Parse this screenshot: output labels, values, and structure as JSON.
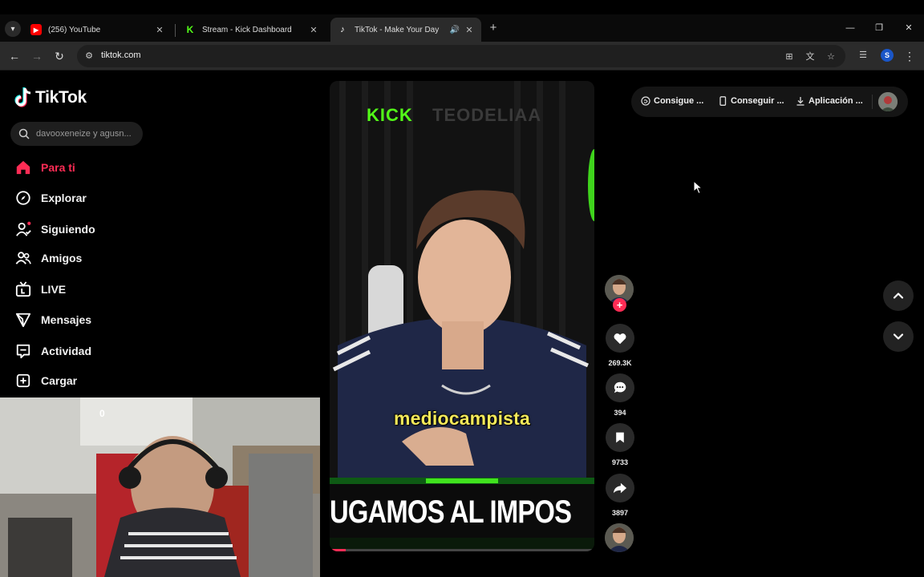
{
  "browser": {
    "tabs": [
      {
        "title": "(256) YouTube",
        "favicon": "youtube-icon",
        "color": "#ff0000"
      },
      {
        "title": "Stream - Kick Dashboard",
        "favicon": "kick-icon",
        "color": "#53fc18"
      },
      {
        "title": "TikTok - Make Your Day",
        "favicon": "tiktok-icon",
        "color": "#ffffff"
      }
    ],
    "url": "tiktok.com",
    "profile_initial": "S"
  },
  "tiktok": {
    "logo": "TikTok",
    "search_placeholder": "davooxeneize y agusn...",
    "nav": [
      {
        "label": "Para ti",
        "icon": "home-icon",
        "active": true
      },
      {
        "label": "Explorar",
        "icon": "compass-icon"
      },
      {
        "label": "Siguiendo",
        "icon": "following-icon"
      },
      {
        "label": "Amigos",
        "icon": "friends-icon"
      },
      {
        "label": "LIVE",
        "icon": "live-icon"
      },
      {
        "label": "Mensajes",
        "icon": "messages-icon"
      },
      {
        "label": "Actividad",
        "icon": "activity-icon"
      },
      {
        "label": "Cargar",
        "icon": "upload-icon"
      }
    ],
    "topbar": {
      "coins": "Consigue ...",
      "get_app": "Conseguir ...",
      "app": "Aplicación ..."
    },
    "video": {
      "kick_logo": "KICK",
      "channel_watermark": "TEODELIAA",
      "caption": "mediocampista",
      "banner": "UGAMOS AL IMPOS",
      "progress": 0.06
    },
    "actions": {
      "likes": "269.3K",
      "comments": "394",
      "saves": "9733",
      "shares": "3897"
    },
    "accent": "#fe2c55"
  },
  "webcam": {
    "overlay_digit": "0"
  }
}
